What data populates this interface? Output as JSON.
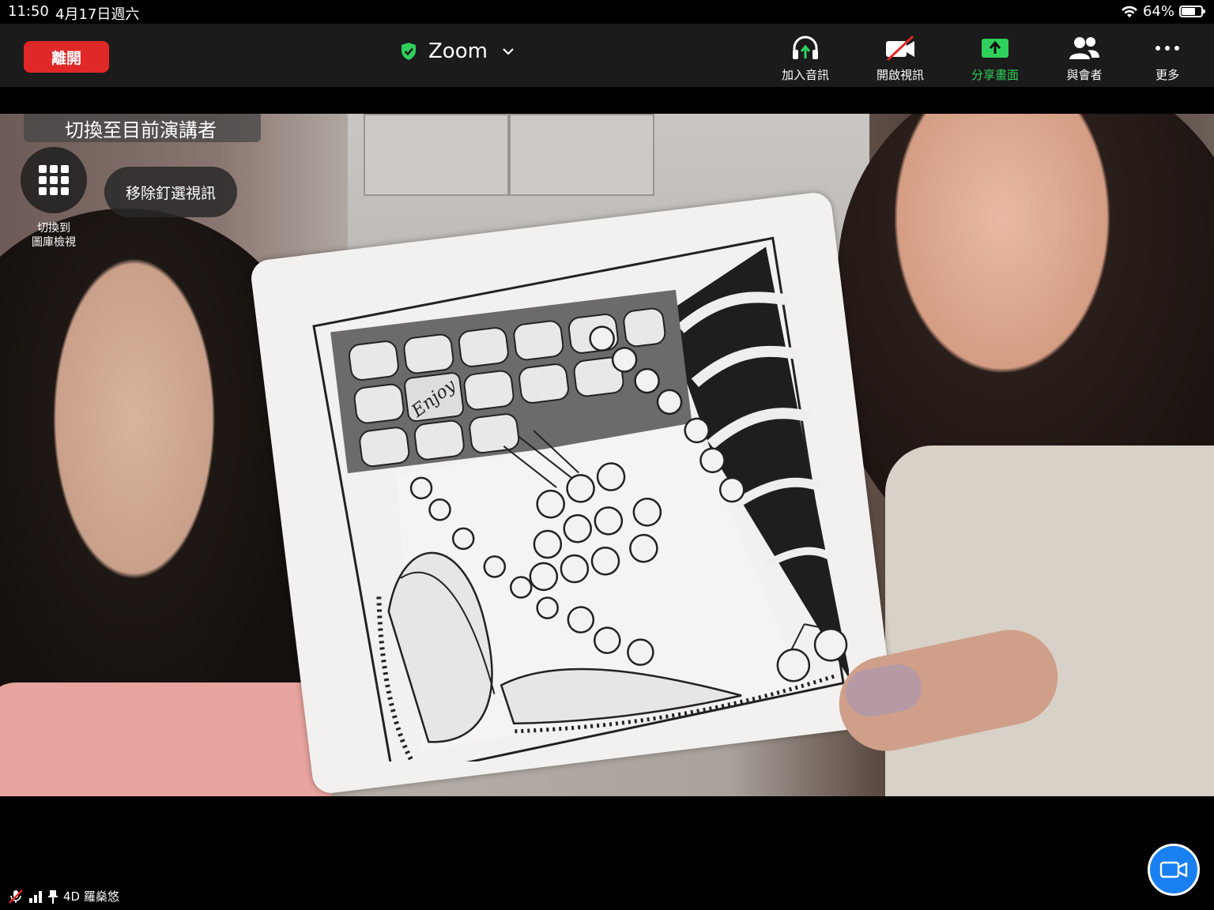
{
  "statusbar": {
    "time": "11:50",
    "date": "4月17日週六",
    "battery": "64%",
    "battery_level": 0.64
  },
  "toolbar": {
    "leave_label": "離開",
    "title": "Zoom",
    "items": [
      {
        "label": "加入音訊",
        "icon": "headphones-icon"
      },
      {
        "label": "開啟視訊",
        "icon": "camera-off-icon"
      },
      {
        "label": "分享畫面",
        "icon": "share-screen-icon"
      },
      {
        "label": "與會者",
        "icon": "participants-icon"
      },
      {
        "label": "更多",
        "icon": "more-icon"
      }
    ],
    "colors": {
      "leave": "#e02828",
      "share": "#2fd05b",
      "shield": "#2fd05b"
    }
  },
  "overlay": {
    "switch_speaker": "切換至目前演講者",
    "gallery_label_line1": "切換到",
    "gallery_label_line2": "圖庫檢視",
    "unpin_label": "移除釘選視訊"
  },
  "drawing": {
    "card_text": "Enjoy"
  },
  "participant": {
    "name": "4D 羅燊悠"
  },
  "camera_button": {
    "icon": "video-camera-icon",
    "color": "#1a7ff0"
  }
}
